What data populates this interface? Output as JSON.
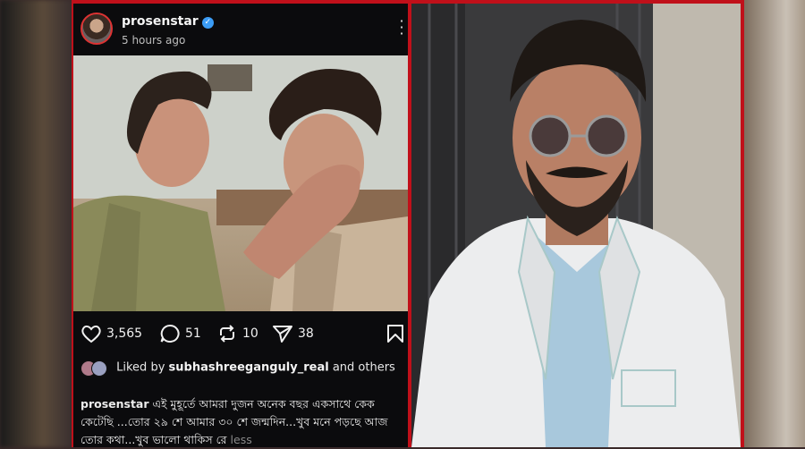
{
  "post": {
    "username": "prosenstar",
    "time_ago": "5 hours ago",
    "likes_count": "3,565",
    "comments_count": "51",
    "reposts_count": "10",
    "shares_count": "38",
    "liked_by_prefix": "Liked by",
    "liked_by_user": "subhashreeganguly_real",
    "liked_by_suffix": "and others",
    "caption_user": "prosenstar",
    "caption_text": "এই মুহূর্তে আমরা দুজন অনেক বছর একসাথে কেক কেটেছি ...তোর ২৯ শে আমার ৩০ শে জন্মদিন...খুব মনে পড়ছে আজ তোর কথা...খুব ভালো থাকিস রে",
    "caption_less": "less"
  },
  "icons": {
    "verified": "verified-badge-icon",
    "more": "more-options-icon",
    "like": "heart-icon",
    "comment": "comment-icon",
    "repost": "repost-icon",
    "share": "send-icon",
    "save": "bookmark-icon"
  },
  "colors": {
    "frame_red": "#c0101a",
    "post_bg": "#0b0b0d",
    "verified_blue": "#3b9cf5",
    "less_gray": "#8a8a8a"
  }
}
